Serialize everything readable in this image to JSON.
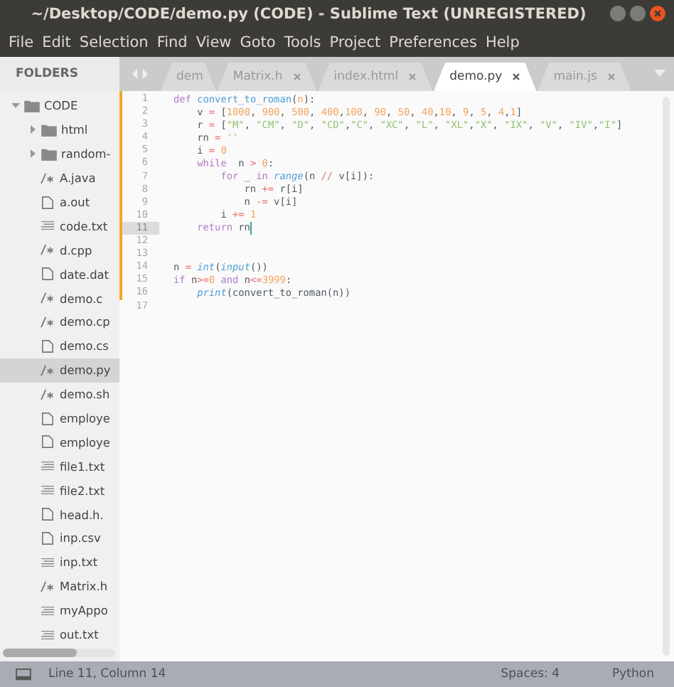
{
  "window": {
    "title": "~/Desktop/CODE/demo.py (CODE) - Sublime Text (UNREGISTERED)"
  },
  "menu": [
    "File",
    "Edit",
    "Selection",
    "Find",
    "View",
    "Goto",
    "Tools",
    "Project",
    "Preferences",
    "Help"
  ],
  "sidebar": {
    "title": "FOLDERS",
    "items": [
      {
        "label": "CODE",
        "kind": "folder",
        "expanded": true,
        "selected": false,
        "children": [
          {
            "label": "html",
            "kind": "folder",
            "expanded": false,
            "selected": false
          },
          {
            "label": "random-",
            "kind": "folder",
            "expanded": false,
            "selected": false
          },
          {
            "label": "A.java",
            "kind": "code",
            "selected": false
          },
          {
            "label": "a.out",
            "kind": "file",
            "selected": false
          },
          {
            "label": "code.txt",
            "kind": "text",
            "selected": false
          },
          {
            "label": "d.cpp",
            "kind": "code",
            "selected": false
          },
          {
            "label": "date.dat",
            "kind": "file",
            "selected": false
          },
          {
            "label": "demo.c",
            "kind": "code",
            "selected": false
          },
          {
            "label": "demo.cp",
            "kind": "code",
            "selected": false
          },
          {
            "label": "demo.cs",
            "kind": "file",
            "selected": false
          },
          {
            "label": "demo.py",
            "kind": "code",
            "selected": true
          },
          {
            "label": "demo.sh",
            "kind": "code",
            "selected": false
          },
          {
            "label": "employe",
            "kind": "file",
            "selected": false
          },
          {
            "label": "employe",
            "kind": "file",
            "selected": false
          },
          {
            "label": "file1.txt",
            "kind": "text",
            "selected": false
          },
          {
            "label": "file2.txt",
            "kind": "text",
            "selected": false
          },
          {
            "label": "head.h.",
            "kind": "file",
            "selected": false
          },
          {
            "label": "inp.csv",
            "kind": "file",
            "selected": false
          },
          {
            "label": "inp.txt",
            "kind": "text",
            "selected": false
          },
          {
            "label": "Matrix.h",
            "kind": "code",
            "selected": false
          },
          {
            "label": "myAppo",
            "kind": "text",
            "selected": false
          },
          {
            "label": "out.txt",
            "kind": "text",
            "selected": false
          }
        ]
      }
    ]
  },
  "tabs": [
    {
      "label": "dem",
      "selected": false,
      "closable": false
    },
    {
      "label": "Matrix.h",
      "selected": false,
      "closable": true
    },
    {
      "label": "index.html",
      "selected": false,
      "closable": true
    },
    {
      "label": "demo.py",
      "selected": true,
      "closable": true
    },
    {
      "label": "main.js",
      "selected": false,
      "closable": true
    }
  ],
  "editor": {
    "lines": [
      {
        "number": "1",
        "current": false,
        "tokens": [
          {
            "text": "def ",
            "kind": "kw"
          },
          {
            "text": "convert_to_roman",
            "kind": "fn"
          },
          {
            "text": "(",
            "kind": "plain"
          },
          {
            "text": "n",
            "kind": "param"
          },
          {
            "text": "):",
            "kind": "plain"
          }
        ]
      },
      {
        "number": "2",
        "current": false,
        "tokens": [
          {
            "text": "    v ",
            "kind": "plain"
          },
          {
            "text": "=",
            "kind": "op"
          },
          {
            "text": " [",
            "kind": "plain"
          },
          {
            "text": "1000",
            "kind": "num"
          },
          {
            "text": ", ",
            "kind": "plain"
          },
          {
            "text": "900",
            "kind": "num"
          },
          {
            "text": ", ",
            "kind": "plain"
          },
          {
            "text": "500",
            "kind": "num"
          },
          {
            "text": ", ",
            "kind": "plain"
          },
          {
            "text": "400",
            "kind": "num"
          },
          {
            "text": ",",
            "kind": "plain"
          },
          {
            "text": "100",
            "kind": "num"
          },
          {
            "text": ", ",
            "kind": "plain"
          },
          {
            "text": "90",
            "kind": "num"
          },
          {
            "text": ", ",
            "kind": "plain"
          },
          {
            "text": "50",
            "kind": "num"
          },
          {
            "text": ", ",
            "kind": "plain"
          },
          {
            "text": "40",
            "kind": "num"
          },
          {
            "text": ",",
            "kind": "plain"
          },
          {
            "text": "10",
            "kind": "num"
          },
          {
            "text": ", ",
            "kind": "plain"
          },
          {
            "text": "9",
            "kind": "num"
          },
          {
            "text": ", ",
            "kind": "plain"
          },
          {
            "text": "5",
            "kind": "num"
          },
          {
            "text": ", ",
            "kind": "plain"
          },
          {
            "text": "4",
            "kind": "num"
          },
          {
            "text": ",",
            "kind": "plain"
          },
          {
            "text": "1",
            "kind": "num"
          },
          {
            "text": "]",
            "kind": "plain"
          }
        ]
      },
      {
        "number": "3",
        "current": false,
        "tokens": [
          {
            "text": "    r ",
            "kind": "plain"
          },
          {
            "text": "=",
            "kind": "op"
          },
          {
            "text": " [",
            "kind": "plain"
          },
          {
            "text": "\"M\"",
            "kind": "str"
          },
          {
            "text": ", ",
            "kind": "plain"
          },
          {
            "text": "\"CM\"",
            "kind": "str"
          },
          {
            "text": ", ",
            "kind": "plain"
          },
          {
            "text": "\"D\"",
            "kind": "str"
          },
          {
            "text": ", ",
            "kind": "plain"
          },
          {
            "text": "\"CD\"",
            "kind": "str"
          },
          {
            "text": ",",
            "kind": "plain"
          },
          {
            "text": "\"C\"",
            "kind": "str"
          },
          {
            "text": ", ",
            "kind": "plain"
          },
          {
            "text": "\"XC\"",
            "kind": "str"
          },
          {
            "text": ", ",
            "kind": "plain"
          },
          {
            "text": "\"L\"",
            "kind": "str"
          },
          {
            "text": ", ",
            "kind": "plain"
          },
          {
            "text": "\"XL\"",
            "kind": "str"
          },
          {
            "text": ",",
            "kind": "plain"
          },
          {
            "text": "\"X\"",
            "kind": "str"
          },
          {
            "text": ", ",
            "kind": "plain"
          },
          {
            "text": "\"IX\"",
            "kind": "str"
          },
          {
            "text": ", ",
            "kind": "plain"
          },
          {
            "text": "\"V\"",
            "kind": "str"
          },
          {
            "text": ", ",
            "kind": "plain"
          },
          {
            "text": "\"IV\"",
            "kind": "str"
          },
          {
            "text": ",",
            "kind": "plain"
          },
          {
            "text": "\"I\"",
            "kind": "str"
          },
          {
            "text": "]",
            "kind": "plain"
          }
        ]
      },
      {
        "number": "4",
        "current": false,
        "tokens": [
          {
            "text": "    rn ",
            "kind": "plain"
          },
          {
            "text": "=",
            "kind": "op"
          },
          {
            "text": " ''",
            "kind": "str"
          }
        ]
      },
      {
        "number": "5",
        "current": false,
        "tokens": [
          {
            "text": "    i ",
            "kind": "plain"
          },
          {
            "text": "=",
            "kind": "op"
          },
          {
            "text": " 0",
            "kind": "num"
          }
        ]
      },
      {
        "number": "6",
        "current": false,
        "tokens": [
          {
            "text": "    while",
            "kind": "kw"
          },
          {
            "text": "  n ",
            "kind": "plain"
          },
          {
            "text": ">",
            "kind": "op"
          },
          {
            "text": " 0",
            "kind": "num"
          },
          {
            "text": ":",
            "kind": "plain"
          }
        ]
      },
      {
        "number": "7",
        "current": false,
        "tokens": [
          {
            "text": "        for",
            "kind": "kw"
          },
          {
            "text": " _ ",
            "kind": "plain"
          },
          {
            "text": "in",
            "kind": "kw"
          },
          {
            "text": " range",
            "kind": "builtin"
          },
          {
            "text": "(n ",
            "kind": "plain"
          },
          {
            "text": "//",
            "kind": "op"
          },
          {
            "text": " v[i]):",
            "kind": "plain"
          }
        ]
      },
      {
        "number": "8",
        "current": false,
        "tokens": [
          {
            "text": "            rn ",
            "kind": "plain"
          },
          {
            "text": "+=",
            "kind": "op"
          },
          {
            "text": " r[i]",
            "kind": "plain"
          }
        ]
      },
      {
        "number": "9",
        "current": false,
        "tokens": [
          {
            "text": "            n ",
            "kind": "plain"
          },
          {
            "text": "-=",
            "kind": "op"
          },
          {
            "text": " v[i]",
            "kind": "plain"
          }
        ]
      },
      {
        "number": "10",
        "current": false,
        "tokens": [
          {
            "text": "        i ",
            "kind": "plain"
          },
          {
            "text": "+=",
            "kind": "op"
          },
          {
            "text": " 1",
            "kind": "num"
          }
        ]
      },
      {
        "number": "11",
        "current": true,
        "tokens": [
          {
            "text": "    return",
            "kind": "kw"
          },
          {
            "text": " rn",
            "kind": "plain"
          }
        ]
      },
      {
        "number": "12",
        "current": false
      },
      {
        "number": "13",
        "current": false
      },
      {
        "number": "14",
        "current": false,
        "tokens": [
          {
            "text": "n ",
            "kind": "plain"
          },
          {
            "text": "=",
            "kind": "op"
          },
          {
            "text": " int",
            "kind": "builtin"
          },
          {
            "text": "(",
            "kind": "plain"
          },
          {
            "text": "input",
            "kind": "builtin"
          },
          {
            "text": "())",
            "kind": "plain"
          }
        ]
      },
      {
        "number": "15",
        "current": false,
        "tokens": [
          {
            "text": "if",
            "kind": "kw"
          },
          {
            "text": " n",
            "kind": "plain"
          },
          {
            "text": ">=",
            "kind": "op"
          },
          {
            "text": "0",
            "kind": "num"
          },
          {
            "text": " and",
            "kind": "kw"
          },
          {
            "text": " n",
            "kind": "plain"
          },
          {
            "text": "<=",
            "kind": "op"
          },
          {
            "text": "3999",
            "kind": "num"
          },
          {
            "text": ":",
            "kind": "plain"
          }
        ]
      },
      {
        "number": "16",
        "current": false,
        "tokens": [
          {
            "text": "    print",
            "kind": "builtin"
          },
          {
            "text": "(convert_to_roman(n))",
            "kind": "plain"
          }
        ]
      },
      {
        "number": "17",
        "current": false
      }
    ]
  },
  "status_bar": {
    "position": "Line 11, Column 14",
    "indentation": "Spaces: 4",
    "syntax": "Python"
  }
}
